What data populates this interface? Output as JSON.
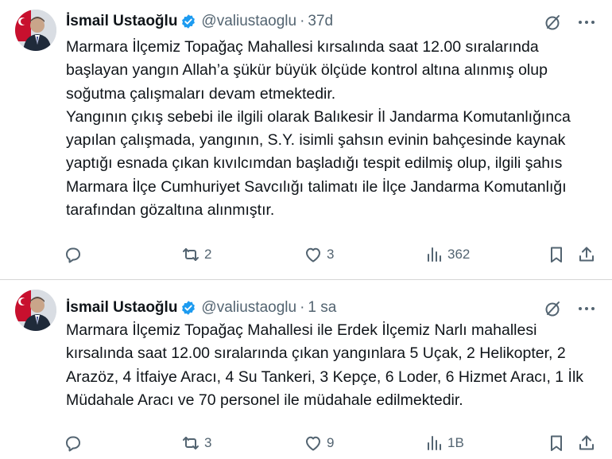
{
  "colors": {
    "accent": "#1d9bf0",
    "text": "#0f1419",
    "muted": "#536471",
    "divider": "#d6d6d6"
  },
  "tweets": [
    {
      "author_name": "İsmail Ustaoğlu",
      "handle": "@valiustaoglu",
      "separator": "·",
      "time": "37d",
      "lines": [
        "Marmara İlçemiz Topağaç Mahallesi kırsalında saat 12.00 sıralarında",
        "başlayan yangın Allah’a şükür büyük ölçüde kontrol altına alınmış olup",
        "soğutma çalışmaları devam etmektedir.",
        "Yangının çıkış sebebi ile ilgili olarak Balıkesir İl Jandarma Komutanlığınca",
        "yapılan çalışmada, yangının, S.Y. isimli şahsın evinin bahçesinde kaynak",
        "yaptığı esnada çıkan kıvılcımdan başladığı tespit edilmiş olup, ilgili şahıs",
        "Marmara İlçe Cumhuriyet Savcılığı talimatı ile İlçe Jandarma Komutanlığı",
        "tarafından gözaltına alınmıştır."
      ],
      "replies": "",
      "retweets": "2",
      "likes": "3",
      "views": "362"
    },
    {
      "author_name": "İsmail Ustaoğlu",
      "handle": "@valiustaoglu",
      "separator": "·",
      "time": "1 sa",
      "lines": [
        "Marmara İlçemiz Topağaç Mahallesi ile Erdek İlçemiz Narlı mahallesi",
        "kırsalında saat 12.00 sıralarında çıkan yangınlara 5 Uçak, 2 Helikopter, 2",
        "Arazöz, 4 İtfaiye Aracı, 4 Su Tankeri, 3 Kepçe, 6 Loder, 6 Hizmet Aracı, 1 İlk",
        "Müdahale Aracı ve 70 personel ile müdahale edilmektedir."
      ],
      "replies": "",
      "retweets": "3",
      "likes": "9",
      "views": "1B"
    }
  ],
  "icons": {
    "verified": "verified-badge-icon",
    "grok": "grok-icon",
    "more": "more-icon",
    "reply": "reply-icon",
    "retweet": "retweet-icon",
    "like": "like-icon",
    "views": "views-icon",
    "bookmark": "bookmark-icon",
    "share": "share-icon"
  }
}
